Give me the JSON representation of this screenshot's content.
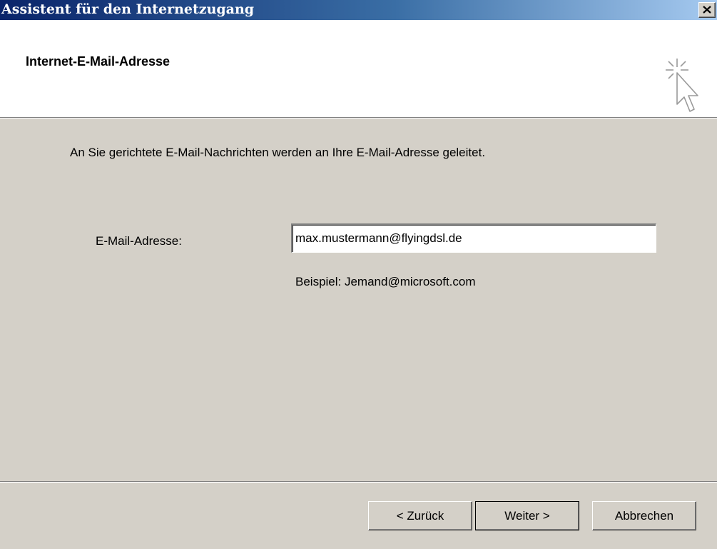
{
  "window": {
    "title": "Assistent für den Internetzugang",
    "close_glyph": "X"
  },
  "header": {
    "title": "Internet-E-Mail-Adresse",
    "icon": "wizard-cursor-icon"
  },
  "main": {
    "intro": "An Sie gerichtete E-Mail-Nachrichten werden an Ihre E-Mail-Adresse geleitet.",
    "email_label": "E-Mail-Adresse:",
    "email_value": "max.mustermann@flyingdsl.de",
    "example": "Beispiel: Jemand@microsoft.com"
  },
  "buttons": {
    "back": "< Zurück",
    "next": "Weiter >",
    "cancel": "Abbrechen"
  }
}
